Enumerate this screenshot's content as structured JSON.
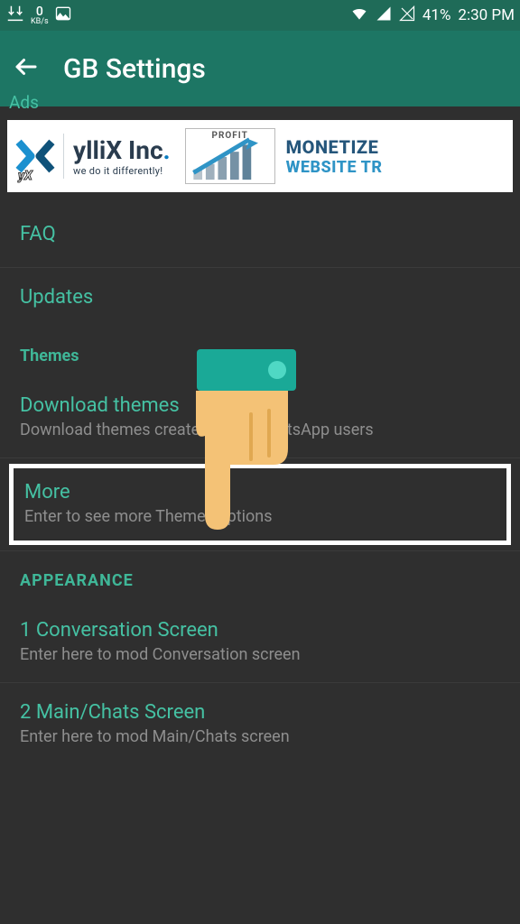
{
  "statusbar": {
    "kbs_value": "0",
    "kbs_unit": "KB/s",
    "battery": "41%",
    "time": "2:30 PM"
  },
  "appbar": {
    "title": "GB Settings"
  },
  "sections": {
    "ads": "Ads",
    "themes": "Themes",
    "appearance": "APPEARANCE"
  },
  "banner": {
    "brand": "ylliX Inc",
    "tagline": "we do it differently!",
    "profit": "PROFIT",
    "cta1": "MONETIZE",
    "cta2": "WEBSITE TR",
    "badge": "yX"
  },
  "items": {
    "faq": {
      "title": "FAQ"
    },
    "updates": {
      "title": "Updates"
    },
    "download_themes": {
      "title": "Download themes",
      "sub": "Download themes created by GBWhatsApp users"
    },
    "more": {
      "title": "More",
      "sub": "Enter to see more Themes options"
    },
    "conversation": {
      "title": "1 Conversation Screen",
      "sub": "Enter here to mod Conversation screen"
    },
    "mainchats": {
      "title": "2 Main/Chats Screen",
      "sub": "Enter here to mod Main/Chats screen"
    }
  }
}
